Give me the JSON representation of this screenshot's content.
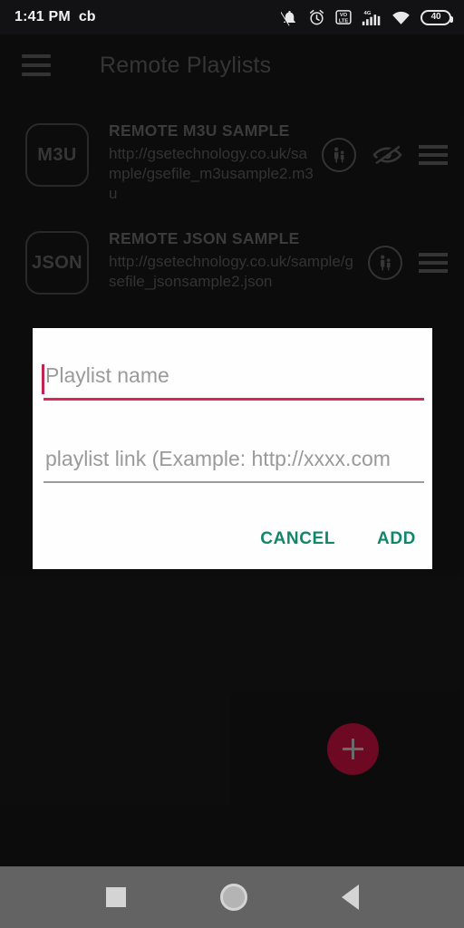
{
  "status_bar": {
    "time": "1:41 PM",
    "carrier_label": "cb",
    "battery_percent": "40",
    "icons": [
      "notifications-off-icon",
      "alarm-icon",
      "volte-icon",
      "signal-4g-icon",
      "wifi-icon",
      "battery-icon"
    ]
  },
  "app_bar": {
    "menu_icon": "hamburger-menu-icon",
    "title": "Remote Playlists"
  },
  "playlists": [
    {
      "badge": "M3U",
      "title": "REMOTE M3U SAMPLE",
      "url": "http://gsetechnology.co.uk/sample/gsefile_m3usample2.m3u",
      "actions": [
        "parental-control-icon",
        "eye-off-icon",
        "drag-handle-icon"
      ]
    },
    {
      "badge": "JSON",
      "title": "REMOTE JSON SAMPLE",
      "url": "http://gsetechnology.co.uk/sample/gsefile_jsonsample2.json",
      "actions": [
        "parental-control-icon",
        "drag-handle-icon"
      ]
    }
  ],
  "fab": {
    "icon": "plus-icon",
    "color": "#9e0d33"
  },
  "dialog": {
    "name_field": {
      "value": "",
      "placeholder": "Playlist name",
      "focused": true,
      "underline_color": "#d8285a"
    },
    "link_field": {
      "value": "",
      "placeholder": "playlist link (Example: http://xxxx.com",
      "focused": false,
      "underline_color": "#9b9b9b"
    },
    "cancel_label": "CANCEL",
    "add_label": "ADD",
    "action_color": "#12866b"
  },
  "nav_bar": {
    "recent_icon": "square-recents-icon",
    "home_icon": "circle-home-icon",
    "back_icon": "triangle-back-icon"
  }
}
